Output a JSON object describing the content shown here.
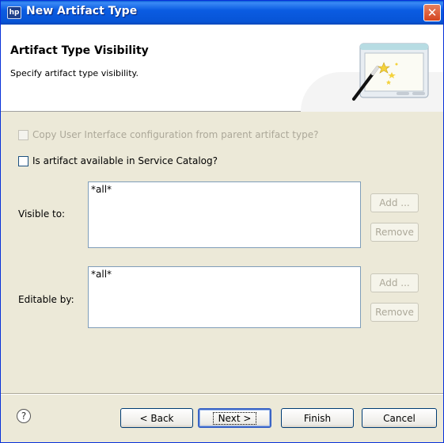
{
  "window": {
    "title": "New Artifact Type",
    "icon_text": "hp",
    "close_label": "✕"
  },
  "header": {
    "title": "Artifact Type Visibility",
    "description": "Specify artifact type visibility."
  },
  "options": {
    "copy_ui_label": "Copy User Interface configuration from parent artifact type?",
    "service_catalog_label": "Is artifact available in Service Catalog?"
  },
  "visible_to": {
    "label": "Visible to:",
    "items": [
      "*all*"
    ],
    "add_label": "Add ...",
    "remove_label": "Remove"
  },
  "editable_by": {
    "label": "Editable by:",
    "items": [
      "*all*"
    ],
    "add_label": "Add ...",
    "remove_label": "Remove"
  },
  "footer": {
    "help_glyph": "?",
    "back_label": "< Back",
    "next_label": "Next >",
    "finish_label": "Finish",
    "cancel_label": "Cancel"
  }
}
